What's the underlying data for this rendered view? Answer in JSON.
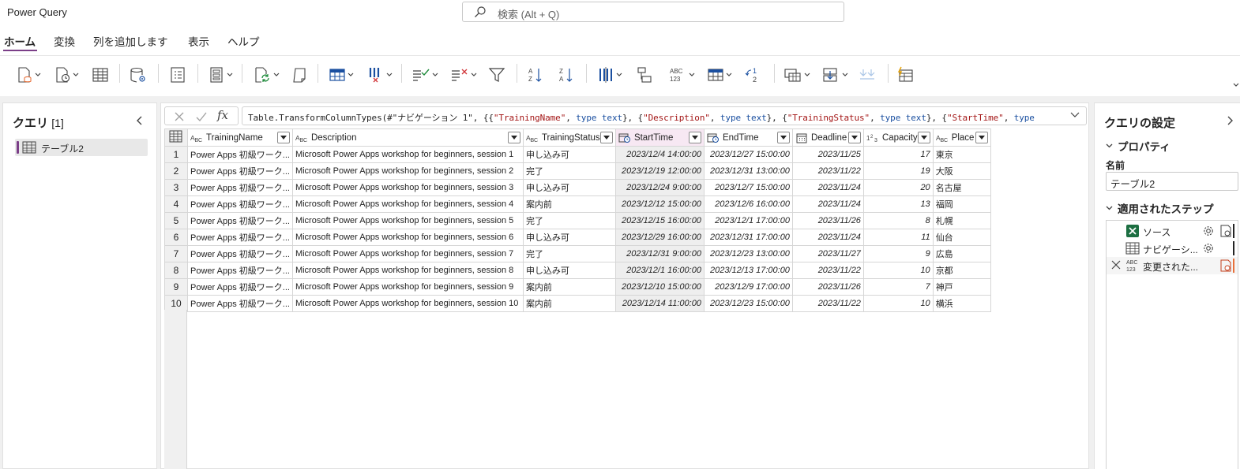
{
  "app": {
    "title": "Power Query"
  },
  "search": {
    "placeholder": "検索 (Alt + Q)"
  },
  "tabs": [
    {
      "label": "ホーム",
      "active": true
    },
    {
      "label": "変換"
    },
    {
      "label": "列を追加します"
    },
    {
      "label": "表示"
    },
    {
      "label": "ヘルプ"
    }
  ],
  "ribbon": {
    "icons": [
      "get-data-icon",
      "recent-sources-icon",
      "enter-data-icon",
      "data-source-settings-icon",
      "options-icon",
      "manage-parameters-icon",
      "refresh-icon",
      "advanced-editor-icon",
      "choose-columns-icon",
      "remove-rows-icon",
      "keep-rows-icon",
      "remove-columns-icon",
      "filter-icon",
      "sort-ascending-icon",
      "sort-descending-icon",
      "split-column-icon",
      "group-by-icon",
      "data-type-icon",
      "use-first-row-as-headers-icon",
      "replace-values-icon",
      "merge-queries-icon",
      "append-queries-icon",
      "combine-files-icon",
      "map-to-entity-icon"
    ],
    "data_type_label_top": "ABC",
    "data_type_label_bottom": "123",
    "replace_values_label": "2"
  },
  "queries": {
    "title": "クエリ",
    "count": "[1]",
    "items": [
      {
        "label": "テーブル2",
        "selected": true
      }
    ]
  },
  "formula": {
    "fx": "fx",
    "text_parts": [
      {
        "t": "Table.TransformColumnTypes(#\"ナビゲーション 1\", {{",
        "c": "#242424"
      },
      {
        "t": "\"TrainingName\"",
        "c": "#a31515"
      },
      {
        "t": ", ",
        "c": "#242424"
      },
      {
        "t": "type text",
        "c": "#1a4fa0"
      },
      {
        "t": "}, {",
        "c": "#242424"
      },
      {
        "t": "\"Description\"",
        "c": "#a31515"
      },
      {
        "t": ", ",
        "c": "#242424"
      },
      {
        "t": "type text",
        "c": "#1a4fa0"
      },
      {
        "t": "}, {",
        "c": "#242424"
      },
      {
        "t": "\"TrainingStatus\"",
        "c": "#a31515"
      },
      {
        "t": ", ",
        "c": "#242424"
      },
      {
        "t": "type text",
        "c": "#1a4fa0"
      },
      {
        "t": "}, {",
        "c": "#242424"
      },
      {
        "t": "\"StartTime\"",
        "c": "#a31515"
      },
      {
        "t": ", ",
        "c": "#242424"
      },
      {
        "t": "type",
        "c": "#1a4fa0"
      }
    ]
  },
  "table": {
    "columns": [
      {
        "name": "TrainingName",
        "type": "ABC",
        "align": "left"
      },
      {
        "name": "Description",
        "type": "ABC",
        "align": "left"
      },
      {
        "name": "TrainingStatus",
        "type": "ABC",
        "align": "left"
      },
      {
        "name": "StartTime",
        "type": "datetime",
        "align": "right",
        "selected": true
      },
      {
        "name": "EndTime",
        "type": "datetime",
        "align": "right"
      },
      {
        "name": "Deadline",
        "type": "date",
        "align": "right"
      },
      {
        "name": "Capacity",
        "type": "123",
        "align": "right"
      },
      {
        "name": "Place",
        "type": "ABC",
        "align": "left"
      }
    ],
    "type_labels": {
      "ABC": "ABC",
      "123": "1²₃"
    },
    "rows": [
      [
        "1",
        "Power Apps 初級ワーク...",
        "Microsoft Power Apps workshop for beginners, session 1",
        "申し込み可",
        "2023/12/4 14:00:00",
        "2023/12/27 15:00:00",
        "2023/11/25",
        "17",
        "東京"
      ],
      [
        "2",
        "Power Apps 初級ワーク...",
        "Microsoft Power Apps workshop for beginners, session 2",
        "完了",
        "2023/12/19 12:00:00",
        "2023/12/31 13:00:00",
        "2023/11/22",
        "19",
        "大阪"
      ],
      [
        "3",
        "Power Apps 初級ワーク...",
        "Microsoft Power Apps workshop for beginners, session 3",
        "申し込み可",
        "2023/12/24 9:00:00",
        "2023/12/7 15:00:00",
        "2023/11/24",
        "20",
        "名古屋"
      ],
      [
        "4",
        "Power Apps 初級ワーク...",
        "Microsoft Power Apps workshop for beginners, session 4",
        "案内前",
        "2023/12/12 15:00:00",
        "2023/12/6 16:00:00",
        "2023/11/24",
        "13",
        "福岡"
      ],
      [
        "5",
        "Power Apps 初級ワーク...",
        "Microsoft Power Apps workshop for beginners, session 5",
        "完了",
        "2023/12/15 16:00:00",
        "2023/12/1 17:00:00",
        "2023/11/26",
        "8",
        "札幌"
      ],
      [
        "6",
        "Power Apps 初級ワーク...",
        "Microsoft Power Apps workshop for beginners, session 6",
        "申し込み可",
        "2023/12/29 16:00:00",
        "2023/12/31 17:00:00",
        "2023/11/24",
        "11",
        "仙台"
      ],
      [
        "7",
        "Power Apps 初級ワーク...",
        "Microsoft Power Apps workshop for beginners, session 7",
        "完了",
        "2023/12/31 9:00:00",
        "2023/12/23 13:00:00",
        "2023/11/27",
        "9",
        "広島"
      ],
      [
        "8",
        "Power Apps 初級ワーク...",
        "Microsoft Power Apps workshop for beginners, session 8",
        "申し込み可",
        "2023/12/1 16:00:00",
        "2023/12/13 17:00:00",
        "2023/11/22",
        "10",
        "京都"
      ],
      [
        "9",
        "Power Apps 初級ワーク...",
        "Microsoft Power Apps workshop for beginners, session 9",
        "案内前",
        "2023/12/10 15:00:00",
        "2023/12/9 17:00:00",
        "2023/11/26",
        "7",
        "神戸"
      ],
      [
        "10",
        "Power Apps 初級ワーク...",
        "Microsoft Power Apps workshop for beginners, session 10",
        "案内前",
        "2023/12/14 11:00:00",
        "2023/12/23 15:00:00",
        "2023/11/22",
        "10",
        "横浜"
      ]
    ]
  },
  "settings": {
    "title": "クエリの設定",
    "properties_label": "プロパティ",
    "name_label": "名前",
    "name_value": "テーブル2",
    "steps_label": "適用されたステップ",
    "steps": [
      {
        "label": "ソース",
        "icon": "excel-icon",
        "gear": true,
        "active": false
      },
      {
        "label": "ナビゲーシ...",
        "icon": "table-icon",
        "gear": true,
        "active": false
      },
      {
        "label": "変更された...",
        "icon": "abc123-icon",
        "gear": false,
        "active": true
      }
    ],
    "step_type_top": "ABC",
    "step_type_bottom": "123"
  },
  "colors": {
    "accent": "#7b3f88",
    "active_step": "#e8703a",
    "excel": "#1d6f42"
  }
}
